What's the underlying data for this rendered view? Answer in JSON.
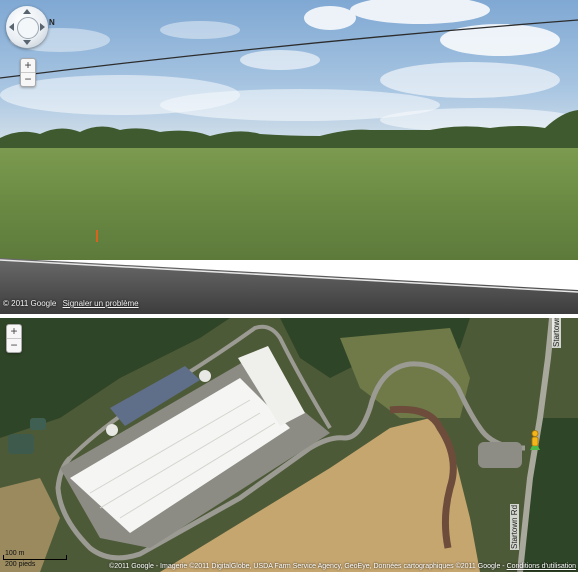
{
  "street_view": {
    "compass_label": "N",
    "icons": {
      "navigation": "pan-arrows-icon",
      "zoom_in": "plus-icon",
      "zoom_out": "minus-icon"
    },
    "zoom": {
      "in_label": "+",
      "out_label": "−"
    },
    "copyright": "© 2011 Google",
    "report_link": "Signaler un problème"
  },
  "map": {
    "zoom": {
      "in_label": "+",
      "out_label": "−"
    },
    "road_label_top": "Startown",
    "road_label_bottom": "Startown Rd",
    "scale": {
      "metric": "100 m",
      "imperial": "200 pieds"
    },
    "attribution": "©2011 Google - Imagerie ©2011 DigitalGlobe, USDA Farm Service Agency, GeoEye, Données cartographiques ©2011 Google - ",
    "terms_link": "Conditions d'utilisation",
    "pegman_icon": "pegman-icon"
  },
  "colors": {
    "sky": "#9fc2e0",
    "grass": "#6f8e47",
    "road": "#5d5d5d",
    "roof": "#f6f6f6",
    "dirt": "#c8a97d"
  }
}
